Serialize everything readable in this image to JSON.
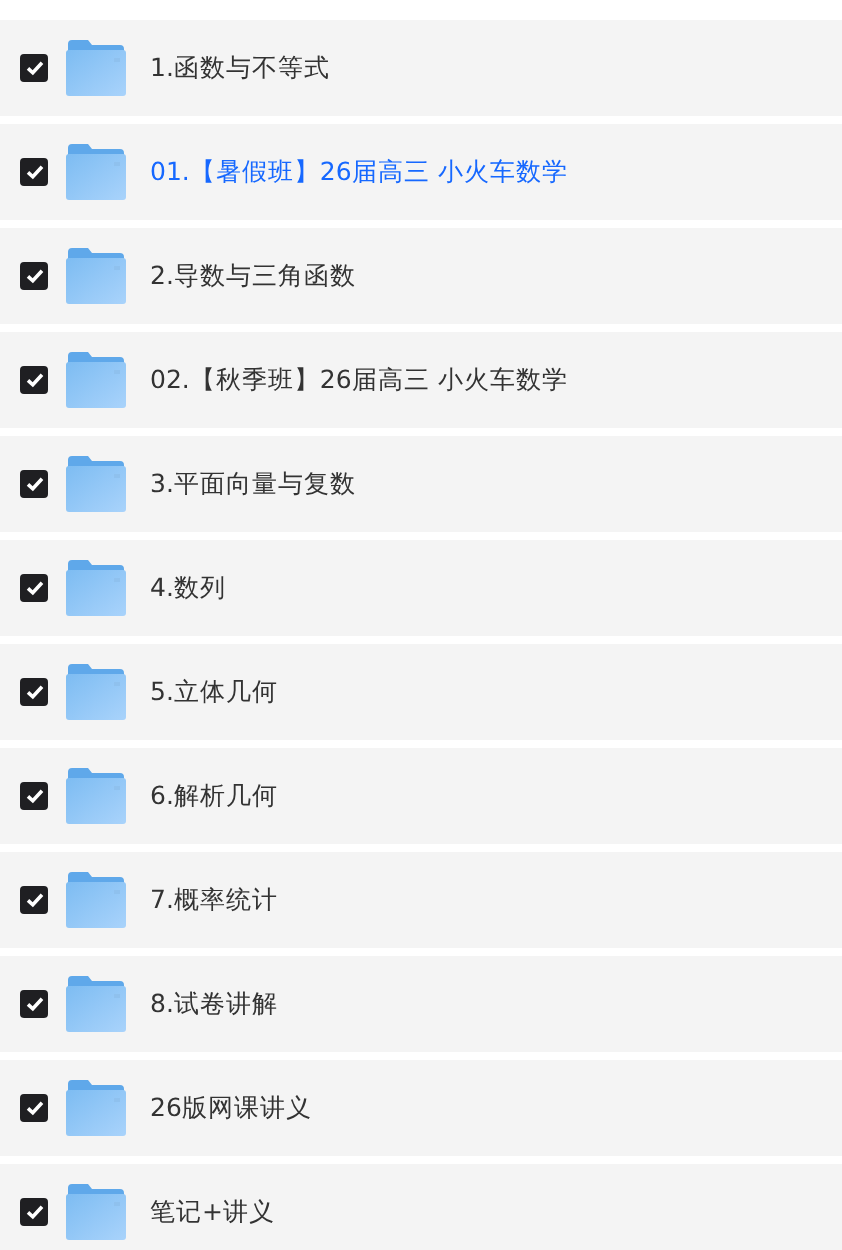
{
  "folders": [
    {
      "name": "1.函数与不等式",
      "checked": true,
      "selected": false
    },
    {
      "name": "01.【暑假班】26届高三 小火车数学",
      "checked": true,
      "selected": true
    },
    {
      "name": "2.导数与三角函数",
      "checked": true,
      "selected": false
    },
    {
      "name": "02.【秋季班】26届高三 小火车数学",
      "checked": true,
      "selected": false
    },
    {
      "name": "3.平面向量与复数",
      "checked": true,
      "selected": false
    },
    {
      "name": "4.数列",
      "checked": true,
      "selected": false
    },
    {
      "name": "5.立体几何",
      "checked": true,
      "selected": false
    },
    {
      "name": "6.解析几何",
      "checked": true,
      "selected": false
    },
    {
      "name": "7.概率统计",
      "checked": true,
      "selected": false
    },
    {
      "name": "8.试卷讲解",
      "checked": true,
      "selected": false
    },
    {
      "name": "26版网课讲义",
      "checked": true,
      "selected": false
    },
    {
      "name": "笔记+讲义",
      "checked": true,
      "selected": false
    }
  ]
}
